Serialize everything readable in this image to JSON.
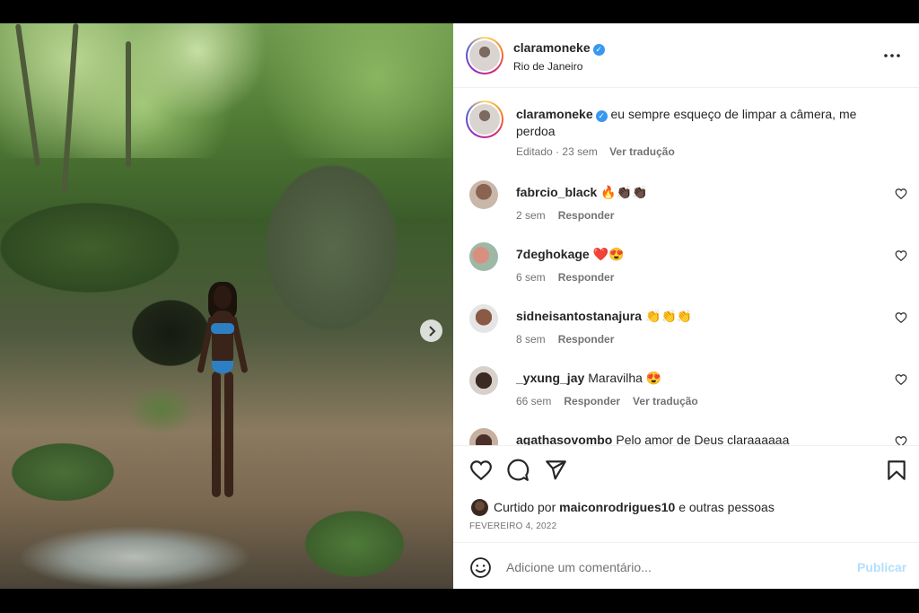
{
  "post": {
    "username": "claramoneke",
    "location": "Rio de Janeiro",
    "caption": "eu sempre esqueço de limpar a câmera, me perdoa",
    "caption_meta": {
      "edited": "Editado",
      "separator": "·",
      "age": "23 sem",
      "translate": "Ver tradução"
    }
  },
  "comments": [
    {
      "user": "fabrcio_black",
      "text": "🔥👏🏿👏🏿",
      "age": "2 sem",
      "reply": "Responder",
      "translate": ""
    },
    {
      "user": "7deghokage",
      "text": "❤️😍",
      "age": "6 sem",
      "reply": "Responder",
      "translate": ""
    },
    {
      "user": "sidneisantostanajura",
      "text": "👏👏👏",
      "age": "8 sem",
      "reply": "Responder",
      "translate": ""
    },
    {
      "user": "_yxung_jay",
      "text": "Maravilha 😍",
      "age": "66 sem",
      "reply": "Responder",
      "translate": "Ver tradução"
    },
    {
      "user": "agathasovombo",
      "text": "Pelo amor de Deus claraaaaaa",
      "age": "",
      "reply": "",
      "translate": ""
    }
  ],
  "likes": {
    "prefix": "Curtido por",
    "user": "maiconrodrigues10",
    "suffix": "e outras pessoas"
  },
  "date": "FEVEREIRO 4, 2022",
  "comment_box": {
    "placeholder": "Adicione um comentário...",
    "publish": "Publicar"
  },
  "icons": {
    "next": "chevron-right-icon",
    "more": "more-horizontal-icon",
    "like": "heart-icon",
    "comment": "comment-icon",
    "share": "send-icon",
    "save": "bookmark-icon",
    "emoji": "emoji-icon"
  },
  "colors": {
    "verified": "#3897f0",
    "publish_disabled": "#b2dffc",
    "secondary_text": "#737373"
  }
}
